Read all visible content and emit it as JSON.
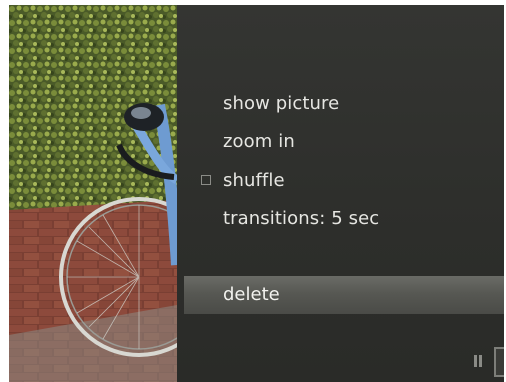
{
  "menu": {
    "items": [
      {
        "label": "show picture"
      },
      {
        "label": "zoom in"
      },
      {
        "label": "shuffle",
        "checked": false
      },
      {
        "label": "transitions: 5 sec"
      }
    ],
    "selected": {
      "label": "delete"
    }
  },
  "controls": {
    "pause_icon": "pause-icon",
    "trash_icon": "trash-icon"
  },
  "colors": {
    "menu_background": "#2f302d",
    "highlight": "#5a5b56",
    "text": "#e6e6e2"
  }
}
